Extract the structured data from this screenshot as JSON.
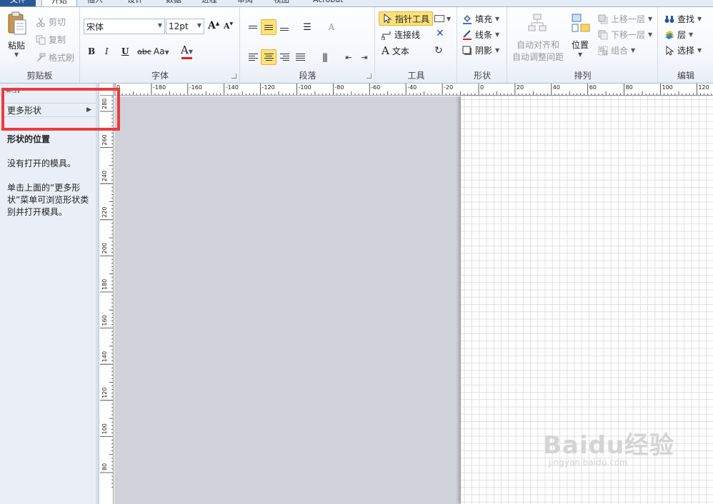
{
  "tabs": [
    {
      "label": "文件"
    },
    {
      "label": "开始"
    },
    {
      "label": "插入"
    },
    {
      "label": "设计"
    },
    {
      "label": "数据"
    },
    {
      "label": "进程"
    },
    {
      "label": "审阅"
    },
    {
      "label": "视图"
    },
    {
      "label": "Acrobat"
    }
  ],
  "clipboard": {
    "paste": "粘贴",
    "cut": "剪切",
    "copy": "复制",
    "format_painter": "格式刷",
    "label": "剪贴板"
  },
  "font": {
    "name": "宋体",
    "size": "12pt",
    "bold": "B",
    "italic": "I",
    "underline": "U",
    "strike": "abc",
    "case": "Aa",
    "color": "A",
    "grow": "A",
    "shrink": "A",
    "label": "字体"
  },
  "paragraph": {
    "label": "段落"
  },
  "tools": {
    "pointer": "指针工具",
    "connector": "连接线",
    "text": "文本",
    "label": "工具"
  },
  "shape": {
    "fill": "填充",
    "line": "线条",
    "shadow": "阴影",
    "label": "形状"
  },
  "arrange": {
    "auto_align": "自动对齐和",
    "auto_space": "自动调整间距",
    "position": "位置",
    "bring_forward": "上移一层",
    "send_backward": "下移一层",
    "group": "组合",
    "label": "排列"
  },
  "editing": {
    "find": "查找",
    "layers": "层",
    "select": "选择",
    "label": "编辑"
  },
  "shapes_pane": {
    "title": "形状",
    "more_shapes": "更多形状",
    "heading": "形状的位置",
    "no_stencils": "没有打开的模具。",
    "hint": "单击上面的“更多形状”菜单可浏览形状类别并打开模具。"
  },
  "ruler": {
    "top_ticks": [
      "0",
      "-180",
      "-160",
      "-140",
      "-120",
      "-100",
      "-80",
      "-60",
      "-40",
      "-20",
      "0",
      "20",
      "40",
      "60",
      "80",
      "100",
      "120"
    ],
    "left_ticks": [
      "280",
      "260",
      "240",
      "220",
      "200",
      "180",
      "160",
      "140",
      "120",
      "100",
      "80"
    ]
  },
  "watermark": {
    "main": "Baidu经验",
    "sub": "jingyan.baidu.com"
  },
  "colors": {
    "file_tab": "#2b579a",
    "highlight": "#ee3b3b",
    "canvas": "#cfd3d9",
    "active_button": "#fde27a",
    "font_color_bar": "#e02020"
  }
}
